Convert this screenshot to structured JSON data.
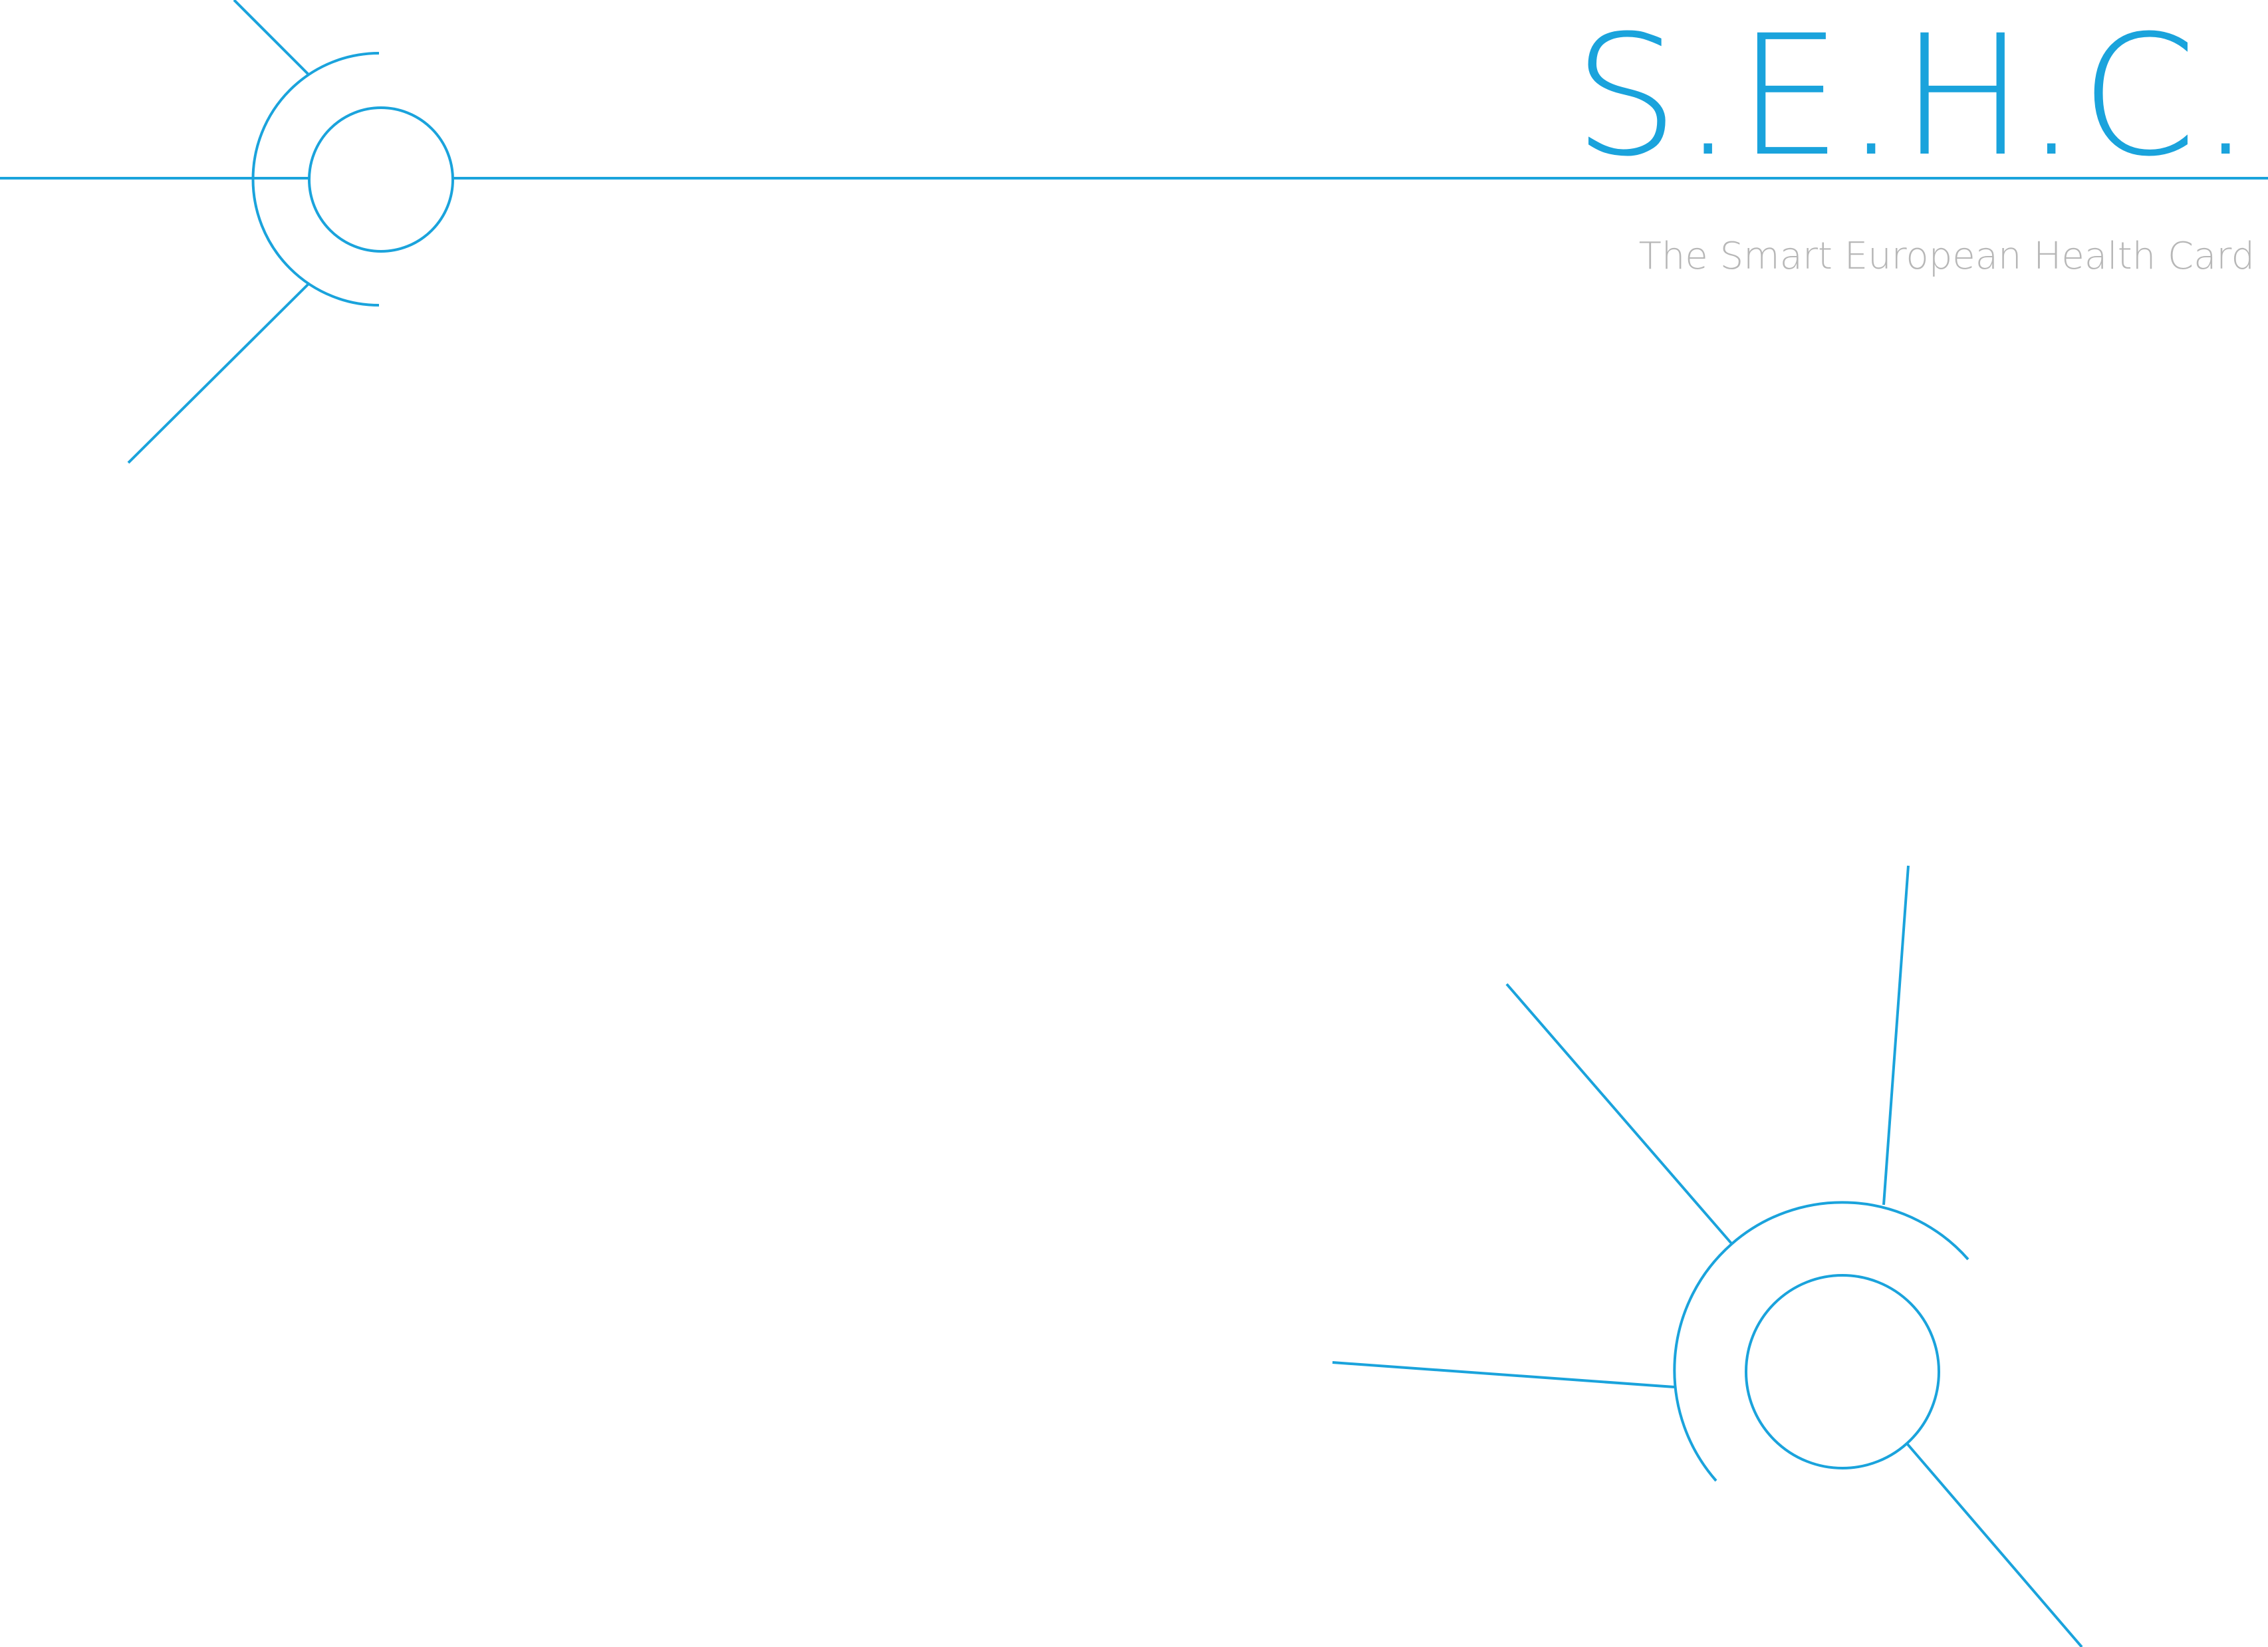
{
  "brand": {
    "logo_text": "S.E.H.C.",
    "tagline": "The Smart European Health Card"
  },
  "icons": {
    "top_left": "network-node-icon",
    "bottom_right": "network-node-icon"
  },
  "colors": {
    "accent": "#1aa3dc",
    "tagline": "#b7b7b7",
    "background": "#ffffff"
  }
}
